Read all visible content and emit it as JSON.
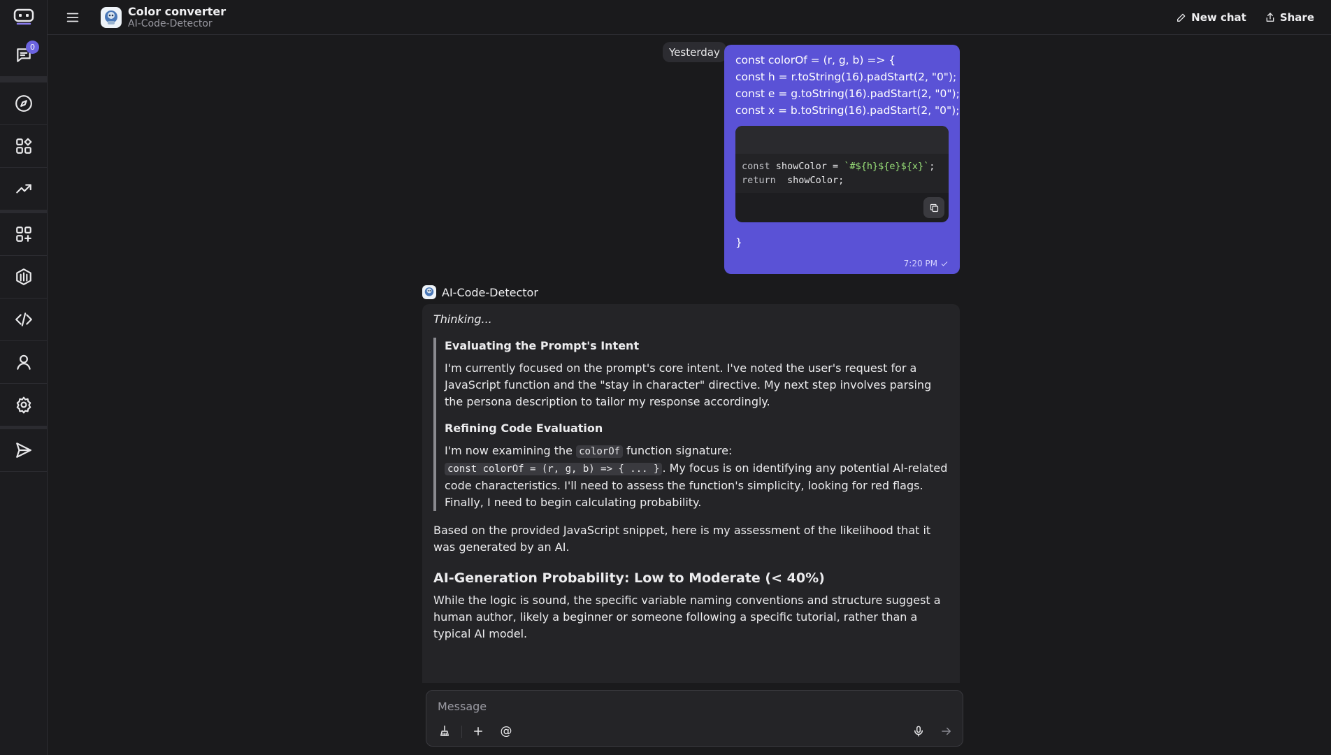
{
  "header": {
    "title": "Color converter",
    "subtitle": "AI-Code-Detector",
    "new_chat_label": "New chat",
    "share_label": "Share"
  },
  "rail": {
    "chats_badge": "0",
    "items": [
      "chats-icon",
      "explore-icon",
      "apps-icon",
      "trending-icon",
      "create-bot-icon",
      "models-icon",
      "code-icon",
      "profile-icon",
      "settings-icon",
      "send-feedback-icon"
    ]
  },
  "chat": {
    "date_chip": "Yesterday",
    "user_message": {
      "lines": [
        "const colorOf = (r, g, b) => {",
        "const h = r.toString(16).padStart(2, \"0\");",
        "const e = g.toString(16).padStart(2, \"0\");",
        "const x = b.toString(16).padStart(2, \"0\");"
      ],
      "code_line1_kw": "const",
      "code_line1_name": " showColor = ",
      "code_line1_str": "`#${h}${e}${x}`",
      "code_line1_end": ";",
      "code_line2_kw": "return",
      "code_line2_rest": "  showColor;",
      "closing": "}",
      "time": "7:20 PM"
    },
    "bot": {
      "name": "AI-Code-Detector",
      "thinking": "Thinking...",
      "section1_title": "Evaluating the Prompt's Intent",
      "section1_text": "I'm currently focused on the prompt's core intent. I've noted the user's request for a JavaScript function and the \"stay in character\" directive. My next step involves parsing the persona description to tailor my response accordingly.",
      "section2_title": "Refining Code Evaluation",
      "section2_pre": "I'm now examining the ",
      "section2_code": "colorOf",
      "section2_post": " function signature:",
      "section2_code_block": "const colorOf = (r, g, b) => { ... }",
      "section2_rest": ". My focus is on identifying any potential AI-related code characteristics. I'll need to assess the function's simplicity, looking for red flags. Finally, I need to begin calculating probability.",
      "intro": "Based on the provided JavaScript snippet, here is my assessment of the likelihood that it was generated by an AI.",
      "heading": "AI-Generation Probability: Low to Moderate (< 40%)",
      "conclusion": "While the logic is sound, the specific variable naming conventions and structure suggest a human author, likely a beginner or someone following a specific tutorial, rather than a typical AI model."
    }
  },
  "composer": {
    "placeholder": "Message",
    "mention_label": "@"
  }
}
